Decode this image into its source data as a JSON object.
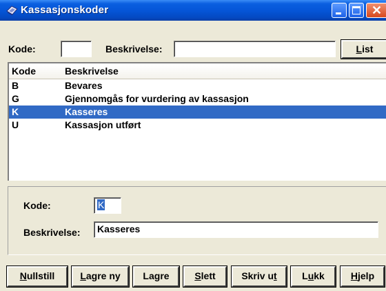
{
  "window": {
    "title": "Kassasjonskoder",
    "min_icon": "minimize-icon",
    "max_icon": "maximize-icon",
    "close_icon": "close-icon"
  },
  "search": {
    "kode_label": "Kode:",
    "kode_value": "",
    "beskrivelse_label": "Beskrivelse:",
    "beskrivelse_value": "",
    "list_button": "List"
  },
  "list": {
    "headers": [
      "Kode",
      "Beskrivelse"
    ],
    "rows": [
      {
        "kode": "B",
        "beskrivelse": "Bevares"
      },
      {
        "kode": "G",
        "beskrivelse": "Gjennomgås for vurdering av kassasjon"
      },
      {
        "kode": "K",
        "beskrivelse": "Kasseres",
        "selected": true
      },
      {
        "kode": "U",
        "beskrivelse": "Kassasjon utført"
      }
    ]
  },
  "detail": {
    "kode_label": "Kode:",
    "kode_value": "K",
    "beskrivelse_label": "Beskrivelse:",
    "beskrivelse_value": "Kasseres"
  },
  "buttons": {
    "nullstill": "Nullstill",
    "lagre_ny": "Lagre ny",
    "lagre": "Lagre",
    "slett": "Slett",
    "skriv_ut": "Skriv ut",
    "lukk": "Lukk",
    "hjelp": "Hjelp"
  },
  "colors": {
    "titlebar": "#0556d8",
    "selection": "#316ac5",
    "face": "#ece9d8"
  }
}
